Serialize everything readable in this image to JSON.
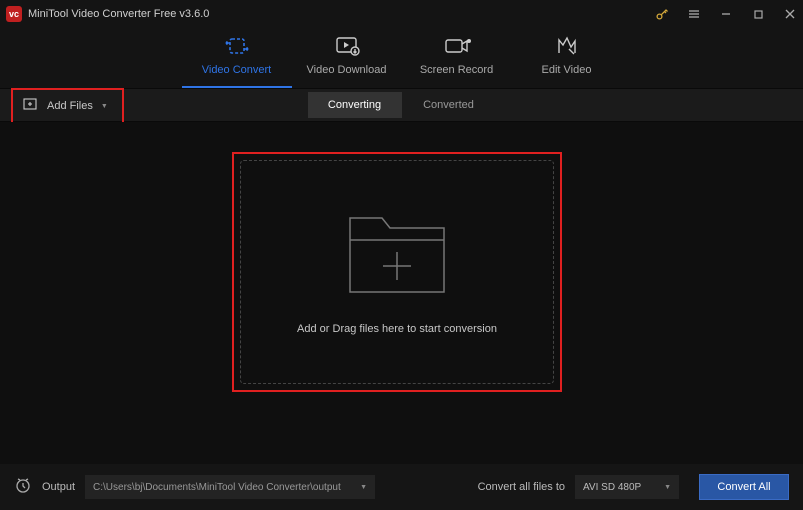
{
  "title": "MiniTool Video Converter Free v3.6.0",
  "nav": [
    {
      "label": "Video Convert"
    },
    {
      "label": "Video Download"
    },
    {
      "label": "Screen Record"
    },
    {
      "label": "Edit Video"
    }
  ],
  "toolbar": {
    "add_files": "Add Files"
  },
  "tabs": {
    "converting": "Converting",
    "converted": "Converted"
  },
  "dropzone": {
    "hint": "Add or Drag files here to start conversion"
  },
  "footer": {
    "output_label": "Output",
    "output_path": "C:\\Users\\bj\\Documents\\MiniTool Video Converter\\output",
    "convert_to_label": "Convert all files to",
    "format": "AVI SD 480P",
    "convert_all": "Convert All"
  }
}
